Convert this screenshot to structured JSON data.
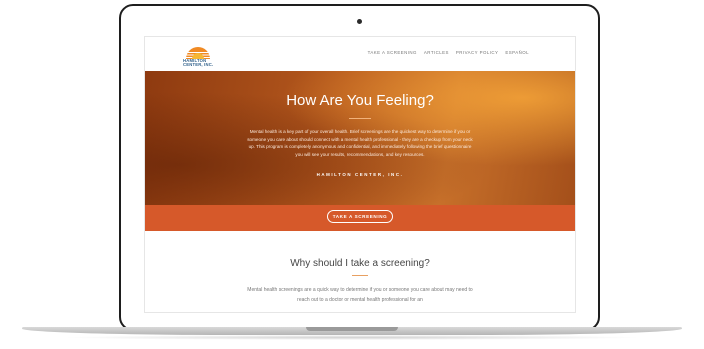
{
  "brand": {
    "name": "HAMILTON\nCENTER, INC.",
    "logo_icon": "sunrise-logo-icon",
    "colors": {
      "accent": "#d6592a",
      "logo_orange": "#f08a24",
      "logo_blue": "#2f5f8a"
    }
  },
  "nav": {
    "items": [
      "TAKE A SCREENING",
      "ARTICLES",
      "PRIVACY POLICY",
      "ESPAÑOL"
    ]
  },
  "hero": {
    "title": "How Are You Feeling?",
    "body": "Mental health is a key part of your overall health. Brief screenings are the quickest way to determine if you or someone you care about should connect with a mental health professional - they are a checkup from your neck up. This program is completely anonymous and confidential, and immediately following the brief questionnaire you will see your results, recommendations, and key resources.",
    "org": "HAMILTON CENTER, INC."
  },
  "cta": {
    "label": "TAKE A SCREENING"
  },
  "section": {
    "title": "Why should I take a screening?",
    "body": "Mental health screenings are a quick way to determine if you or someone you care about may need to reach out to a doctor or mental health professional for an"
  }
}
